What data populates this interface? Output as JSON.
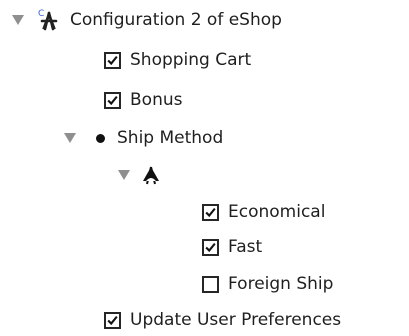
{
  "config": {
    "label": "Configuration 2 of eShop",
    "config_icon": "configuration-icon",
    "badge": "C"
  },
  "items": {
    "shopping_cart": {
      "label": "Shopping Cart",
      "checked": true
    },
    "bonus": {
      "label": "Bonus",
      "checked": true
    },
    "ship_method": {
      "label": "Ship Method",
      "icon": "bullet-dot-icon"
    },
    "alternative_group": {
      "icon": "alternative-group-icon"
    },
    "economical": {
      "label": "Economical",
      "checked": true
    },
    "fast": {
      "label": "Fast",
      "checked": true
    },
    "foreign_ship": {
      "label": "Foreign Ship",
      "checked": false
    },
    "update_user_preferences": {
      "label": "Update User Preferences",
      "checked": true
    }
  },
  "colors": {
    "disclosure": "#8f8f8f",
    "text": "#1f1f1f",
    "badge": "#3b5fd1"
  }
}
